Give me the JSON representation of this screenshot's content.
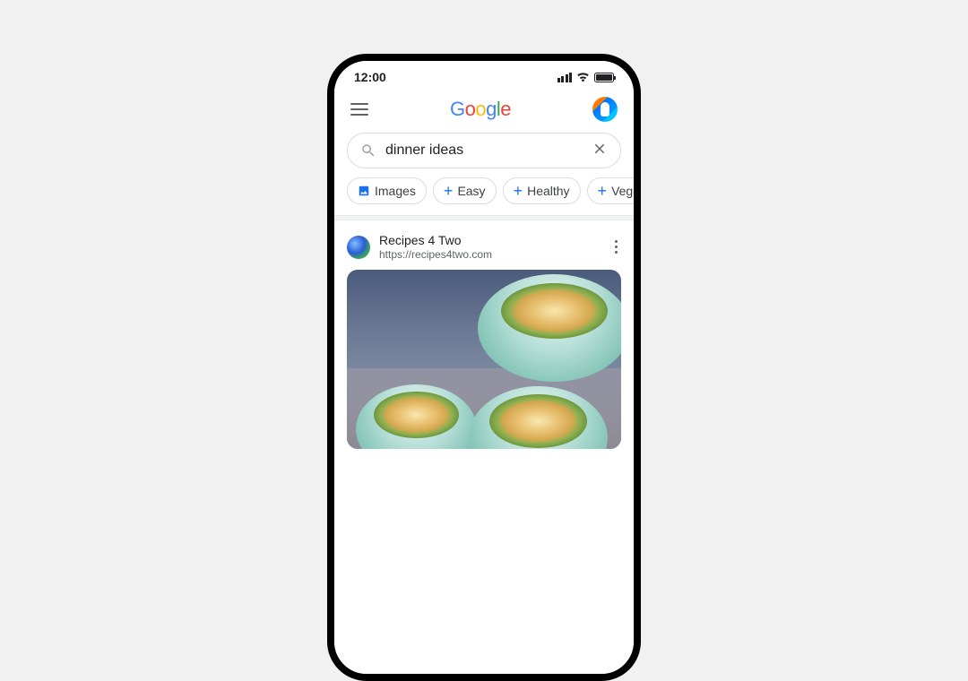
{
  "status": {
    "time": "12:00"
  },
  "header": {
    "logo_chars": [
      "G",
      "o",
      "o",
      "g",
      "l",
      "e"
    ]
  },
  "search": {
    "query": "dinner ideas"
  },
  "chips": [
    {
      "label": "Images",
      "type": "image"
    },
    {
      "label": "Easy",
      "type": "add"
    },
    {
      "label": "Healthy",
      "type": "add"
    },
    {
      "label": "Veget",
      "type": "add"
    }
  ],
  "result": {
    "site_name": "Recipes 4 Two",
    "site_url": "https://recipes4two.com"
  }
}
